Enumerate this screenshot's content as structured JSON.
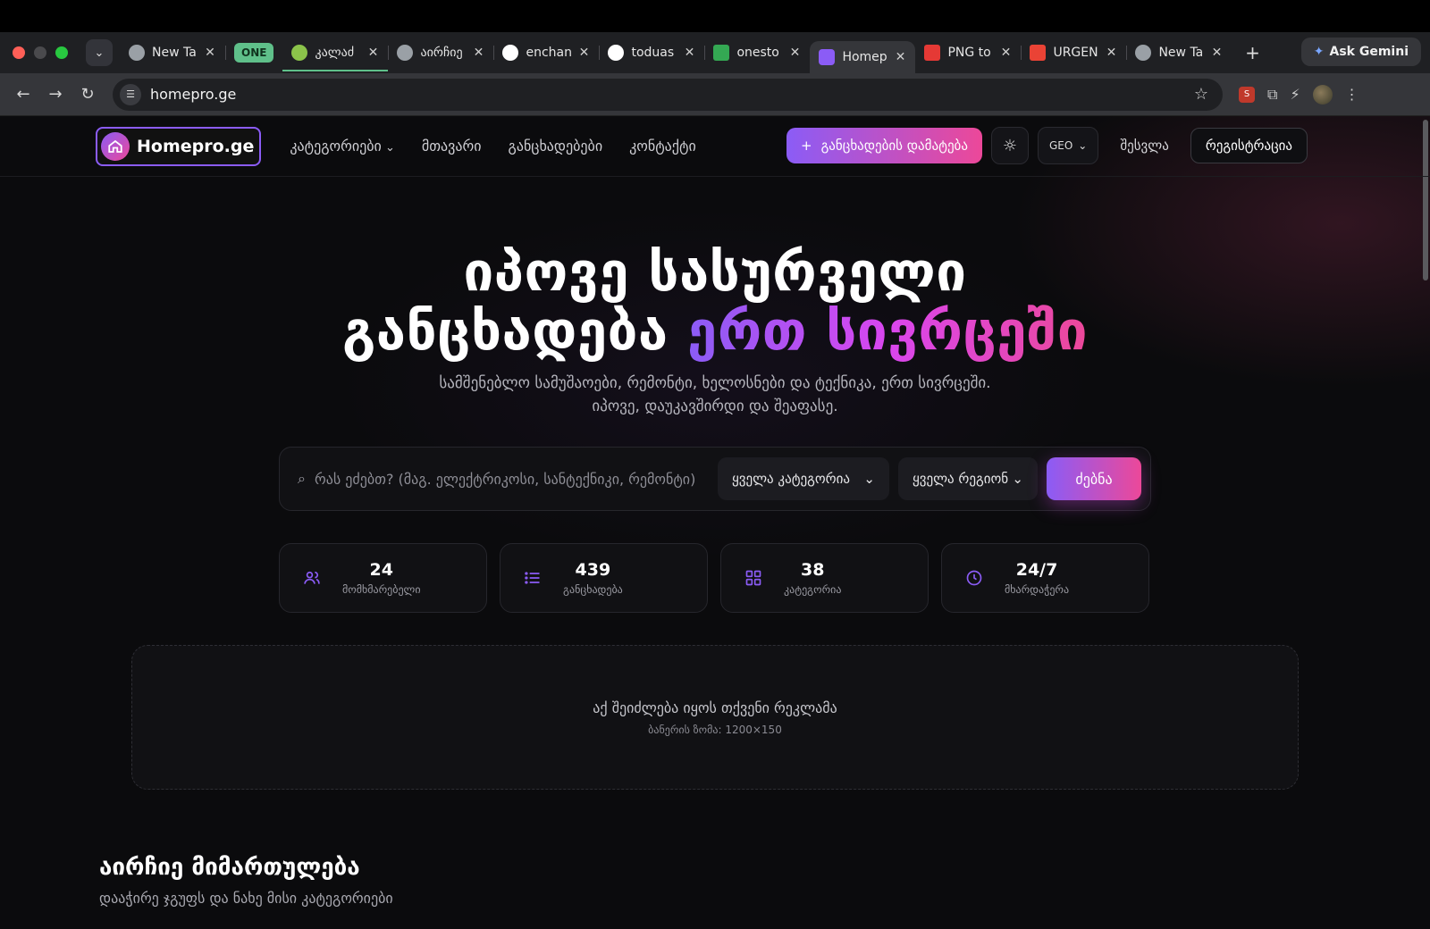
{
  "browser": {
    "tabs": [
      {
        "title": "New Ta",
        "icon": "chrome-icon",
        "color": "#9aa0a6"
      },
      {
        "title": "კალაძ",
        "icon": "globe-icon",
        "color": "#8bc34a",
        "group": "ONE"
      },
      {
        "title": "აირჩიე",
        "icon": "globe-icon",
        "color": "#9aa0a6"
      },
      {
        "title": "enchan",
        "icon": "spotify-icon",
        "color": "#ffffff"
      },
      {
        "title": "toduas",
        "icon": "github-icon",
        "color": "#ffffff"
      },
      {
        "title": "onesto",
        "icon": "sheets-icon",
        "color": "#34a853"
      },
      {
        "title": "Homep",
        "icon": "homepro-icon",
        "color": "#8b5cf6",
        "active": true
      },
      {
        "title": "PNG to",
        "icon": "pdf-icon",
        "color": "#e53935"
      },
      {
        "title": "URGEN",
        "icon": "gmail-icon",
        "color": "#ea4335"
      },
      {
        "title": "New Ta",
        "icon": "chrome-icon",
        "color": "#9aa0a6"
      }
    ],
    "tab_group_label": "ONE",
    "ask_gemini": "Ask Gemini",
    "url": "homepro.ge"
  },
  "header": {
    "logo": "Homepro.ge",
    "nav": [
      "კატეგორიები",
      "მთავარი",
      "განცხადებები",
      "კონტაქტი"
    ],
    "cta": "განცხადების დამატება",
    "lang": "GEO",
    "login": "შესვლა",
    "register": "რეგისტრაცია"
  },
  "hero": {
    "title_line1": "იპოვე სასურველი",
    "title_line2_plain": "განცხადება ",
    "title_line2_accent": "ერთ სივრცეში",
    "subtitle": "სამშენებლო სამუშაოები, რემონტი, ხელოსნები და ტექნიკა, ერთ სივრცეში. იპოვე, დაუკავშირდი და შეაფასე."
  },
  "search": {
    "placeholder": "რას ეძებთ? (მაგ. ელექტრიკოსი, სანტექნიკი, რემონტი)",
    "category": "ყველა კატეგორია",
    "region": "ყველა რეგიონ",
    "button": "ძებნა"
  },
  "stats": [
    {
      "value": "24",
      "label": "მომხმარებელი",
      "icon": "users-icon"
    },
    {
      "value": "439",
      "label": "განცხადება",
      "icon": "list-icon"
    },
    {
      "value": "38",
      "label": "კატეგორია",
      "icon": "grid-icon"
    },
    {
      "value": "24/7",
      "label": "მხარდაჭერა",
      "icon": "clock-icon"
    }
  ],
  "banner": {
    "title": "აქ შეიძლება იყოს თქვენი რეკლამა",
    "size": "ბანერის ზომა: 1200×150"
  },
  "section": {
    "title": "აირჩიე მიმართულება",
    "subtitle": "დააჭირე ჯგუფს და ნახე მისი კატეგორიები"
  },
  "colors": {
    "accent_start": "#8b5cf6",
    "accent_end": "#ec4899",
    "background": "#0b0b0d"
  }
}
